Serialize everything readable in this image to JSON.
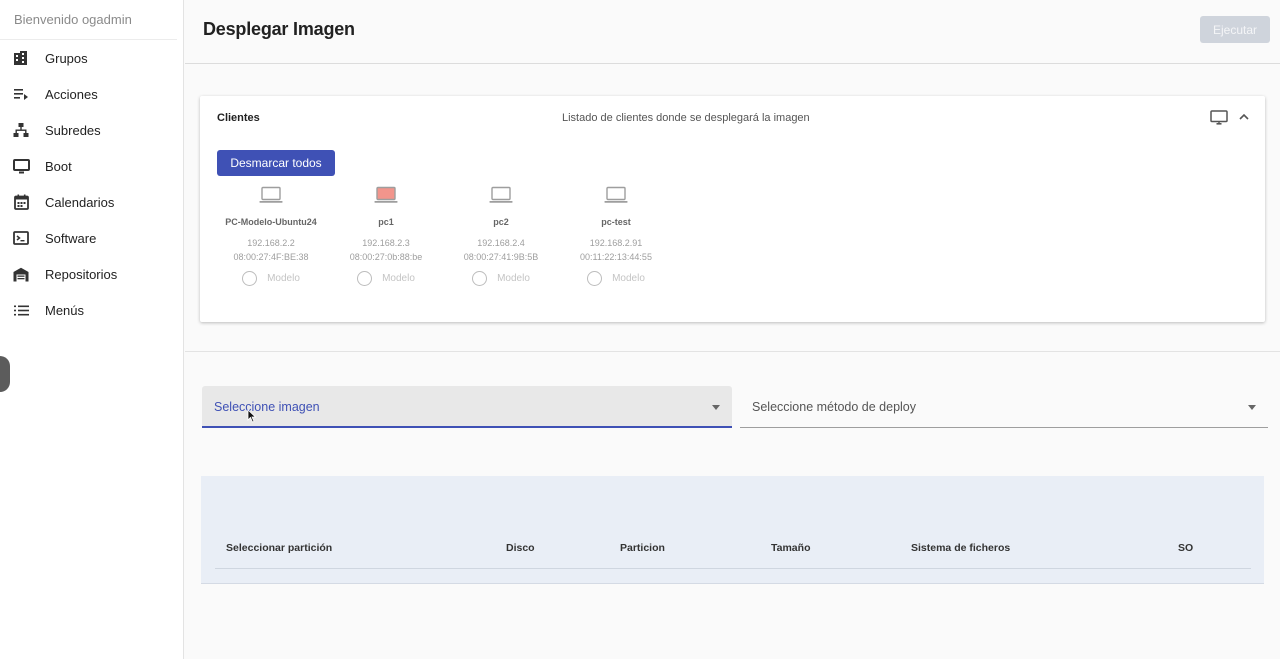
{
  "sidebar": {
    "welcome": "Bienvenido ogadmin",
    "items": [
      {
        "label": "Grupos",
        "icon": "building-icon"
      },
      {
        "label": "Acciones",
        "icon": "playlist-icon"
      },
      {
        "label": "Subredes",
        "icon": "sitemap-icon"
      },
      {
        "label": "Boot",
        "icon": "monitor-icon"
      },
      {
        "label": "Calendarios",
        "icon": "calendar-icon"
      },
      {
        "label": "Software",
        "icon": "terminal-icon"
      },
      {
        "label": "Repositorios",
        "icon": "warehouse-icon"
      },
      {
        "label": "Menús",
        "icon": "list-icon"
      }
    ]
  },
  "header": {
    "title": "Desplegar Imagen",
    "execute_label": "Ejecutar"
  },
  "clients_card": {
    "title": "Clientes",
    "subtitle": "Listado de clientes donde se desplegará la imagen",
    "unmark_label": "Desmarcar todos",
    "clients": [
      {
        "name": "PC-Modelo-Ubuntu24",
        "ip": "192.168.2.2",
        "mac": "08:00:27:4F:BE:38",
        "radio_label": "Modelo",
        "status_color": "#ffffff"
      },
      {
        "name": "pc1",
        "ip": "192.168.2.3",
        "mac": "08:00:27:0b:88:be",
        "radio_label": "Modelo",
        "status_color": "#f2958c"
      },
      {
        "name": "pc2",
        "ip": "192.168.2.4",
        "mac": "08:00:27:41:9B:5B",
        "radio_label": "Modelo",
        "status_color": "#ffffff"
      },
      {
        "name": "pc-test",
        "ip": "192.168.2.91",
        "mac": "00:11:22:13:44:55",
        "radio_label": "Modelo",
        "status_color": "#ffffff"
      }
    ]
  },
  "image_select": {
    "placeholder": "Seleccione imagen"
  },
  "deploy_select": {
    "placeholder": "Seleccione método de deploy"
  },
  "partition_table": {
    "headers": [
      "Seleccionar partición",
      "Disco",
      "Particion",
      "Tamaño",
      "Sistema de ficheros",
      "SO"
    ]
  },
  "colors": {
    "accent": "#3f51b5",
    "execute_disabled": "#cfd4dc",
    "table_bg": "#e9eef6"
  }
}
